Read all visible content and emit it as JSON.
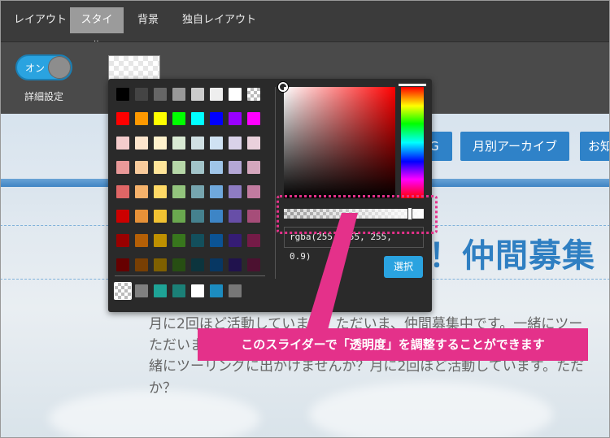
{
  "tabs": [
    "レイアウト",
    "スタイル",
    "背景",
    "独自レイアウト"
  ],
  "active_tab_index": 1,
  "toggle": {
    "label": "オン",
    "state": "on"
  },
  "advanced_settings_label": "詳細設定",
  "page": {
    "nav_buttons": [
      "G",
      "月別アーカイブ",
      "お知"
    ],
    "heading": "！仲間募集",
    "body_lines": [
      "月に2回ほど活動しています。ただいま、仲間募集中です。一緒にツー",
      "ただいま",
      "緒にツーリングに出かけませんか？月に2回ほど活動しています。ただ",
      "か？"
    ]
  },
  "picker": {
    "palette_rows": [
      [
        "#000000",
        "#444444",
        "#666666",
        "#999999",
        "#cccccc",
        "#eeeeee",
        "#ffffff",
        "transparent"
      ],
      [
        "#ff0000",
        "#ff9900",
        "#ffff00",
        "#00ff00",
        "#00ffff",
        "#0000ff",
        "#9900ff",
        "#ff00ff"
      ],
      [
        "#f4cccc",
        "#fce5cd",
        "#fff2cc",
        "#d9ead3",
        "#d0e0e3",
        "#cfe2f3",
        "#d9d2e9",
        "#ead1dc"
      ],
      [
        "#ea9999",
        "#f9cb9c",
        "#ffe599",
        "#b6d7a8",
        "#a2c4c9",
        "#9fc5e8",
        "#b4a7d6",
        "#d5a6bd"
      ],
      [
        "#e06666",
        "#f6b26b",
        "#ffd966",
        "#93c47d",
        "#76a5af",
        "#6fa8dc",
        "#8e7cc3",
        "#c27ba0"
      ],
      [
        "#cc0000",
        "#e69138",
        "#f1c232",
        "#6aa84f",
        "#45818e",
        "#3d85c6",
        "#674ea7",
        "#a64d79"
      ],
      [
        "#990000",
        "#b45f06",
        "#bf9000",
        "#38761d",
        "#134f5c",
        "#0b5394",
        "#351c75",
        "#741b47"
      ],
      [
        "#660000",
        "#783f04",
        "#7f6000",
        "#274e13",
        "#0c343d",
        "#073763",
        "#20124d",
        "#4c1130"
      ]
    ],
    "recent_colors": [
      "transparent",
      "#808080",
      "#1ea396",
      "#1b8077",
      "#ffffff",
      "#1c8cc0",
      "#777777"
    ],
    "alpha": 0.9,
    "value_text": "rgba(255, 255, 255, 0.9)",
    "select_label": "選択"
  },
  "callout": {
    "text": "このスライダーで「透明度」を調整することができます"
  },
  "colors": {
    "accent": "#2aa3e0",
    "annotation": "#e4318a",
    "nav_blue": "#2f82c8"
  }
}
